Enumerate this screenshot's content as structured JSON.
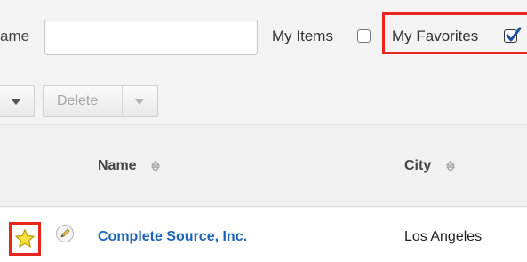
{
  "filter": {
    "name_label": "ame",
    "name_value": "",
    "my_items_label": "My Items",
    "my_items_checked": false,
    "my_favorites_label": "My Favorites",
    "my_favorites_checked": true
  },
  "toolbar": {
    "delete_label": "Delete"
  },
  "columns": {
    "name": "Name",
    "city": "City"
  },
  "rows": [
    {
      "name": "Complete Source, Inc.",
      "city": "Los Angeles",
      "favorite": true
    }
  ],
  "colors": {
    "highlight": "#e8261b",
    "link": "#1d63b8",
    "star": "#f7e13a"
  },
  "icons": {
    "checkbox_checked": "check-icon",
    "sort": "sort-icon",
    "favorite": "star-icon",
    "edit": "pencil-icon",
    "dropdown": "chevron-down-icon"
  }
}
